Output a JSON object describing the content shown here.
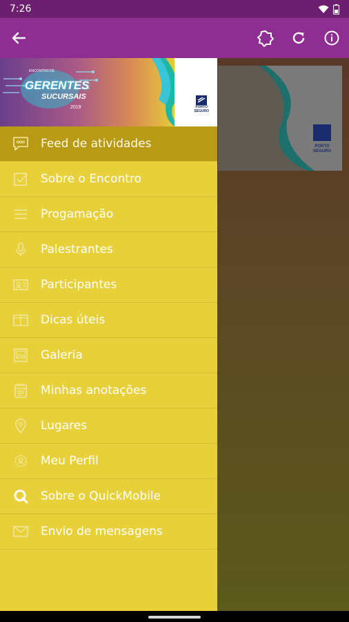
{
  "status_bar": {
    "time": "7:26"
  },
  "app_bar": {
    "back_icon": "arrow-left-icon",
    "actions": [
      {
        "icon": "badge-icon"
      },
      {
        "icon": "refresh-icon"
      },
      {
        "icon": "info-icon"
      }
    ]
  },
  "drawer": {
    "banner": {
      "pre_title": "ENCONTRO DE",
      "title": "GERENTES",
      "subtitle": "SUCURSAIS",
      "year": "2019",
      "brand_line1": "PORTO",
      "brand_line2": "SEGURO"
    },
    "items": [
      {
        "label": "Feed de atividades",
        "icon": "chat-bubble-icon",
        "active": true
      },
      {
        "label": "Sobre o Encontro",
        "icon": "checkbox-icon"
      },
      {
        "label": "Progamação",
        "icon": "list-icon"
      },
      {
        "label": "Palestrantes",
        "icon": "microphone-icon"
      },
      {
        "label": "Participantes",
        "icon": "contact-card-icon"
      },
      {
        "label": "Dicas úteis",
        "icon": "book-icon"
      },
      {
        "label": "Galeria",
        "icon": "image-icon"
      },
      {
        "label": "Minhas anotações",
        "icon": "notepad-icon"
      },
      {
        "label": "Lugares",
        "icon": "map-pin-icon"
      },
      {
        "label": "Meu Perfil",
        "icon": "profile-gear-icon"
      },
      {
        "label": "Sobre o QuickMobile",
        "icon": "quickmobile-logo-icon"
      },
      {
        "label": "Envio de mensagens",
        "icon": "envelope-icon"
      }
    ]
  },
  "colors": {
    "status_bar": "#6c1f6e",
    "app_bar": "#8f2e92",
    "drawer": "#e8d03a",
    "drawer_active": "#b89a16",
    "icon_tint": "#f3e7a0"
  }
}
